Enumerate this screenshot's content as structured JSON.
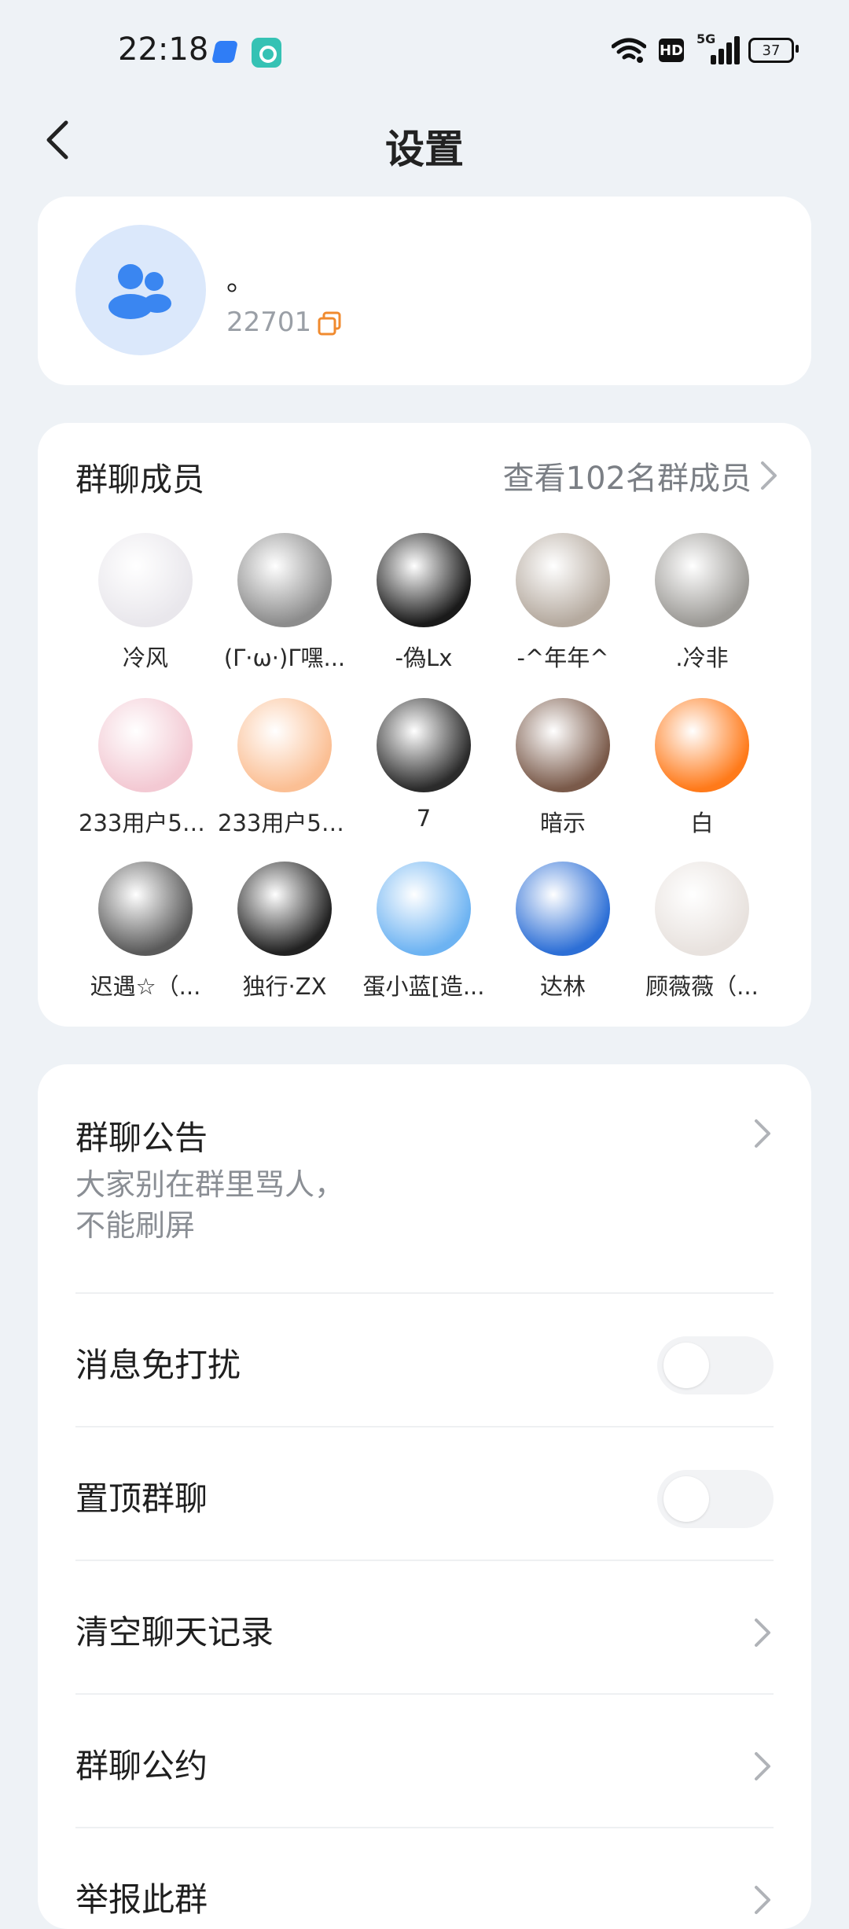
{
  "status_bar": {
    "time": "22:18",
    "hd": "HD",
    "network": "5G",
    "battery": "37"
  },
  "header": {
    "title": "设置"
  },
  "group": {
    "name": "。",
    "id": "22701"
  },
  "members_section": {
    "title": "群聊成员",
    "view_all": "查看102名群成员",
    "members": [
      {
        "name": "冷风",
        "color": "#e9e7ec"
      },
      {
        "name": "(Γ·ω·)Γ嘿...",
        "color": "#8c8c8c"
      },
      {
        "name": "-偽Lx",
        "color": "#1a1a1a"
      },
      {
        "name": "-^年年^",
        "color": "#b5aa9f"
      },
      {
        "name": ".冷非",
        "color": "#9c9a96"
      },
      {
        "name": "233用户52...",
        "color": "#f3c9d3"
      },
      {
        "name": "233用户52...",
        "color": "#fbbf94"
      },
      {
        "name": "7",
        "color": "#2b2b2b"
      },
      {
        "name": "暗示",
        "color": "#7a5a4a"
      },
      {
        "name": "白",
        "color": "#ff7a1a"
      },
      {
        "name": "迟遇☆（...",
        "color": "#5a5a5a"
      },
      {
        "name": "独行·ZX",
        "color": "#222222"
      },
      {
        "name": "蛋小蓝[造...",
        "color": "#6db3f2"
      },
      {
        "name": "达林",
        "color": "#2d6fd6"
      },
      {
        "name": "顾薇薇（...",
        "color": "#e8e2de"
      }
    ]
  },
  "settings": {
    "announcement": {
      "label": "群聊公告",
      "content_line1": "大家别在群里骂人，",
      "content_line2": "不能刷屏"
    },
    "mute": {
      "label": "消息免打扰",
      "on": false
    },
    "pin": {
      "label": "置顶群聊",
      "on": false
    },
    "clear": {
      "label": "清空聊天记录"
    },
    "rules": {
      "label": "群聊公约"
    },
    "report": {
      "label": "举报此群"
    }
  }
}
